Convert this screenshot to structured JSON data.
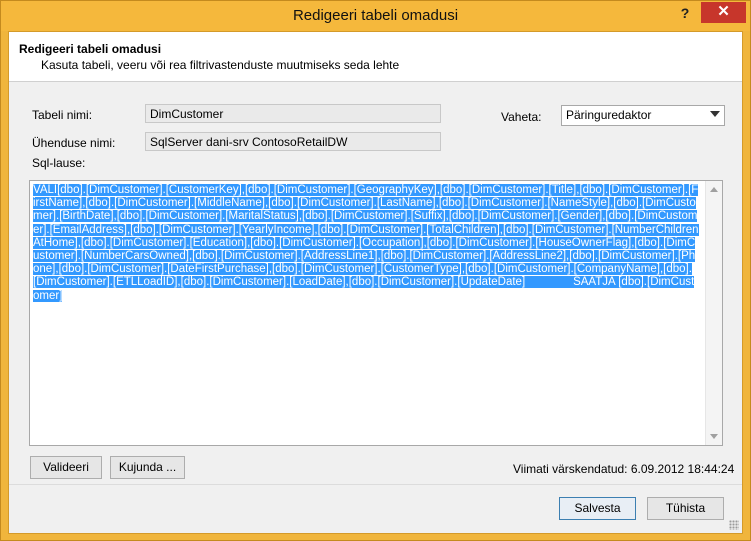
{
  "window": {
    "title": "Redigeeri tabeli omadusi",
    "help_label": "?",
    "close_label": "✕"
  },
  "header": {
    "title": "Redigeeri tabeli omadusi",
    "subtitle": "Kasuta tabeli, veeru või rea filtrivastenduste muutmiseks seda lehte"
  },
  "form": {
    "table_name_label": "Tabeli nimi:",
    "table_name_value": "DimCustomer",
    "connection_name_label": "Ühenduse nimi:",
    "connection_name_value": "SqlServer dani-srv ContosoRetailDW",
    "switch_label": "Vaheta:",
    "switch_value": "Päringuredaktor",
    "sql_label": "Sql-lause:",
    "sql_text": "VALI[dbo].[DimCustomer].[CustomerKey],[dbo].[DimCustomer].[GeographyKey],[dbo].[DimCustomer].[Title],[dbo].[DimCustomer].[FirstName],[dbo].[DimCustomer].[MiddleName],[dbo].[DimCustomer].[LastName],[dbo].[DimCustomer].[NameStyle],[dbo].[DimCustomer].[BirthDate],[dbo].[DimCustomer].[MaritalStatus],[dbo].[DimCustomer].[Suffix],[dbo].[DimCustomer].[Gender],[dbo].[DimCustomer].[EmailAddress],[dbo].[DimCustomer].[YearlyIncome],[dbo].[DimCustomer].[TotalChildren],[dbo].[DimCustomer].[NumberChildrenAtHome],[dbo].[DimCustomer].[Education],[dbo].[DimCustomer].[Occupation],[dbo].[DimCustomer].[HouseOwnerFlag],[dbo].[DimCustomer].[NumberCarsOwned],[dbo].[DimCustomer].[AddressLine1],[dbo].[DimCustomer].[AddressLine2],[dbo].[DimCustomer].[Phone],[dbo].[DimCustomer].[DateFirstPurchase],[dbo].[DimCustomer].[CustomerType],[dbo].[DimCustomer].[CompanyName],[dbo].[DimCustomer].[ETLLoadID],[dbo].[DimCustomer].[LoadDate],[dbo].[DimCustomer].[UpdateDate]               SAATJA [dbo].[DimCustomer]"
  },
  "buttons": {
    "validate": "Valideeri",
    "design": "Kujunda ...",
    "save": "Salvesta",
    "cancel": "Tühista"
  },
  "status": {
    "last_refreshed": "Viimati värskendatud: 6.09.2012 18:44:24"
  },
  "colors": {
    "frame": "#f5b83c",
    "close_button": "#c7362b",
    "selection": "#3399ff"
  }
}
